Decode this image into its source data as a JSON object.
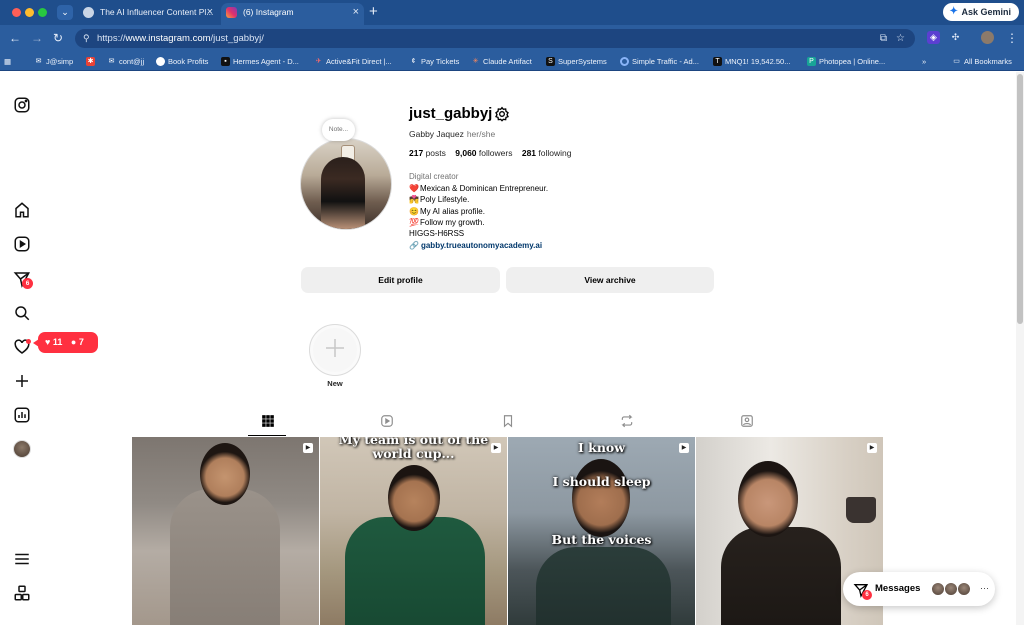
{
  "browser": {
    "tabs": [
      {
        "label": "The AI Influencer Content Pl...",
        "active": false
      },
      {
        "label": "(6) Instagram",
        "active": true
      }
    ],
    "ask_gemini": "Ask Gemini",
    "url_prefix": "https://",
    "url_host": "www.instagram.com",
    "url_path": "/just_gabbyj/",
    "bookmarks": [
      "J@simp",
      "",
      "cont@jj",
      "Book Profits",
      "Hermes Agent - D...",
      "Active&Fit Direct |...",
      "Pay Tickets",
      "Claude Artifact",
      "SuperSystems",
      "Simple Traffic - Ad...",
      "MNQ1! 19,542.50...",
      "Photopea | Online..."
    ],
    "bookmarks_overflow": "»",
    "all_bookmarks": "All Bookmarks"
  },
  "sidebar": {
    "notifications_badge": "6",
    "pill_likes": "11",
    "pill_follows": "7"
  },
  "profile": {
    "note": "Note...",
    "username": "just_gabbyj",
    "full_name": "Gabby Jaquez",
    "pronouns": "her/she",
    "posts_count": "217",
    "posts_label": "posts",
    "followers_count": "9,060",
    "followers_label": "followers",
    "following_count": "281",
    "following_label": "following",
    "category": "Digital creator",
    "bio": [
      {
        "emoji": "❤️",
        "text": "Mexican & Dominican Entrepreneur."
      },
      {
        "emoji": "💏",
        "text": "Poly Lifestyle."
      },
      {
        "emoji": "😊",
        "text": "My AI alias profile."
      },
      {
        "emoji": "💯",
        "text": "Follow my growth."
      },
      {
        "emoji": "",
        "text": "HIGGS-H6RSS"
      }
    ],
    "link": "gabby.trueautonomyacademy.ai",
    "edit_profile": "Edit profile",
    "view_archive": "View archive",
    "highlight_new": "New"
  },
  "posts": [
    {
      "caption": ""
    },
    {
      "caption": "My team is out of the world cup..."
    },
    {
      "caption_top": "I know",
      "caption_mid": "I should sleep",
      "caption_bottom": "But the voices"
    },
    {
      "caption": ""
    }
  ],
  "messages": {
    "label": "Messages",
    "badge": "6",
    "more": "···"
  },
  "colors": {
    "accent_red": "#ff3040",
    "link_blue": "#00376b",
    "chrome_blue": "#2b5d9e"
  }
}
